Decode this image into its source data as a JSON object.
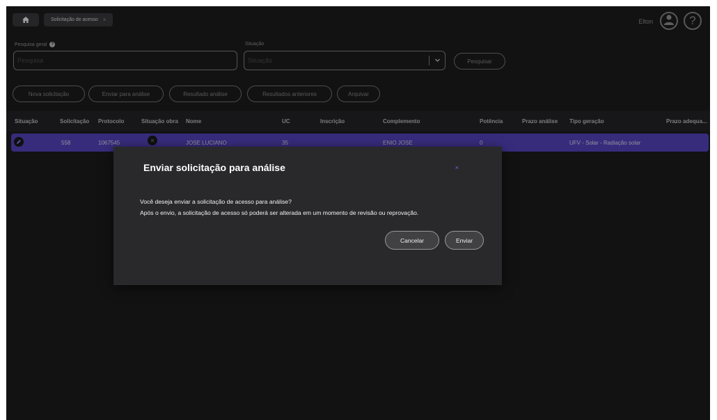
{
  "topbar": {
    "tab_label": "Solicitação de acesso",
    "tab_close": "×",
    "user_name": "Elton",
    "help_glyph": "?"
  },
  "search": {
    "general_label": "Pesquisa geral",
    "general_placeholder": "Pesquisa",
    "situacao_label": "Situação",
    "situacao_placeholder": "Situação",
    "search_button": "Pesquisar"
  },
  "actions": {
    "nova": "Nova solicitação",
    "enviar": "Enviar para análise",
    "resultado": "Resultado análise",
    "anteriores": "Resultados anteriores",
    "arquivar": "Arquivar"
  },
  "table": {
    "columns": [
      "Situação",
      "Solicitação",
      "Protocolo",
      "Situação obra",
      "Nome",
      "UC",
      "Inscrição",
      "Complemento",
      "Potência",
      "Prazo análise",
      "Tipo geração",
      "Prazo adequa..."
    ],
    "rows": [
      {
        "solicitacao": "558",
        "protocolo": "1067545",
        "nome": "JOSE LUCIANO",
        "uc": "35",
        "inscricao": "",
        "complemento": "ENIO JOSE",
        "potencia": "0",
        "prazo_analise": "",
        "tipo_geracao": "UFV - Solar - Radiação solar",
        "prazo_adequacao": ""
      }
    ]
  },
  "modal": {
    "title": "Enviar solicitação para análise",
    "close": "×",
    "line1": "Você deseja enviar a solicitação de acesso para análise?",
    "line2": "Após o envio, a solicitação de acesso só poderá ser alterada em um momento de revisão ou reprovação.",
    "cancel": "Cancelar",
    "confirm": "Enviar"
  },
  "colors": {
    "background": "#1d1d1f",
    "row_selected": "#5a48c9",
    "modal_bg": "#29292b",
    "accent": "#6e66e0"
  },
  "icons": [
    "home-icon",
    "close-icon",
    "user-avatar-icon",
    "help-icon",
    "info-icon",
    "chevron-down-icon",
    "edit-icon",
    "status-icon"
  ]
}
